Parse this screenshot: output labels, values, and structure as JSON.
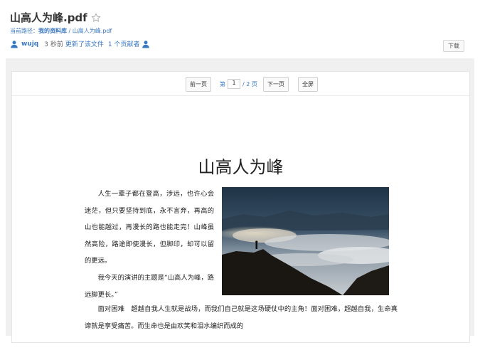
{
  "header": {
    "title": "山高人为峰.pdf",
    "breadcrumb": {
      "prefix": "当前路径：",
      "library": "我的资料库",
      "separator": " / ",
      "file": "山高人为峰.pdf"
    },
    "meta": {
      "user": "wujq",
      "time": "3 秒前",
      "action": "更新了该文件",
      "contributors": "1 个贡献者"
    },
    "download_label": "下载"
  },
  "toolbar": {
    "prev_label": "前一页",
    "page_prefix": "第",
    "current_page": "1",
    "page_total": "/ 2 页",
    "next_label": "下一页",
    "fullscreen_label": "全屏"
  },
  "document": {
    "title": "山高人为峰",
    "para1": "人生一辈子都在登高，涉远，也许心会迷茫，但只要坚持到底，永不言弃，再高的山也能越过，再漫长的路也能走完！山峰虽然高险，路途即使漫长，但脚印，却可以留的更远。",
    "para2": "我今天的演讲的主题是“山高人为峰，路远脚更长。”",
    "para3": "面对困难　超越自我人生就是战场，而我们自己就是这场硬仗中的主角！面对困难，超越自我，生命真谛就是享受痛苦。而生命也是由欢笑和泪水编织而成的"
  },
  "colors": {
    "link": "#3a78c2",
    "background": "#f0f0f0"
  },
  "icons": [
    "star-icon",
    "user-icon",
    "contributor-icon"
  ]
}
